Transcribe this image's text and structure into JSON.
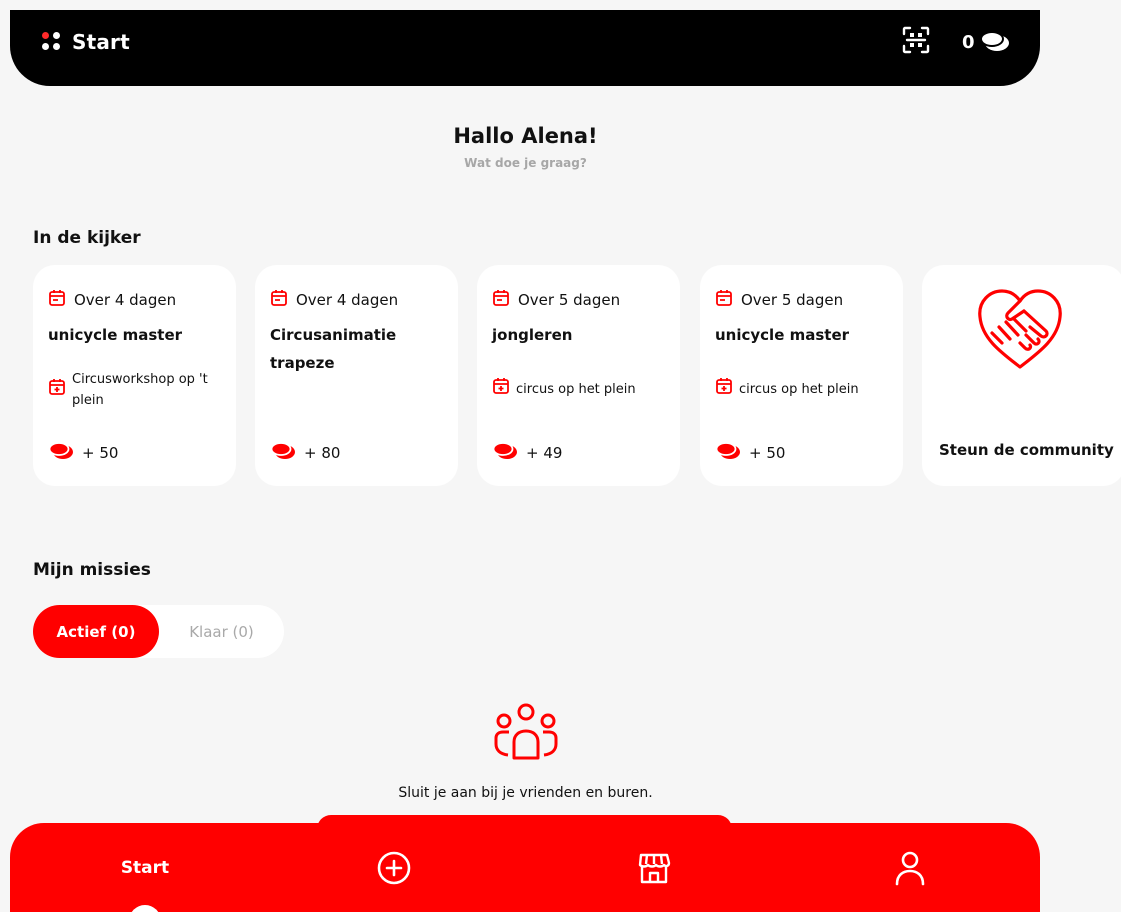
{
  "colors": {
    "accent": "#ff0000",
    "background": "#f6f6f6",
    "topbar": "#000000"
  },
  "topbar": {
    "title": "Start",
    "logo_icon": "four-dots-icon",
    "scan_icon": "qr-scan-icon",
    "coin_balance": "0",
    "coin_icon": "coin-stack-icon"
  },
  "greeting": {
    "title": "Hallo Alena!",
    "subtitle": "Wat doe je graag?"
  },
  "featured": {
    "section_title": "In de kijker",
    "cards": [
      {
        "when": "Over 4 dagen",
        "title": "unicycle master",
        "location": "Circusworkshop op 't plein",
        "reward": "+ 50"
      },
      {
        "when": "Over 4 dagen",
        "title": "Circusanimatie trapeze",
        "location": "",
        "reward": "+ 80"
      },
      {
        "when": "Over 5 dagen",
        "title": "jongleren",
        "location": "circus op het plein",
        "reward": "+ 49"
      },
      {
        "when": "Over 5 dagen",
        "title": "unicycle master",
        "location": "circus op het plein",
        "reward": "+ 50"
      }
    ],
    "community_card": {
      "label": "Steun de community",
      "icon": "heart-handshake-icon"
    }
  },
  "missions": {
    "section_title": "Mijn missies",
    "tabs": [
      {
        "label": "Actief (0)",
        "active": true
      },
      {
        "label": "Klaar (0)",
        "active": false
      }
    ],
    "empty_icon": "group-icon",
    "empty_text": "Sluit je aan bij je vrienden en buren."
  },
  "bottom_nav": {
    "start_label": "Start",
    "add_icon": "plus-circle-icon",
    "shop_icon": "store-icon",
    "profile_icon": "user-icon"
  }
}
